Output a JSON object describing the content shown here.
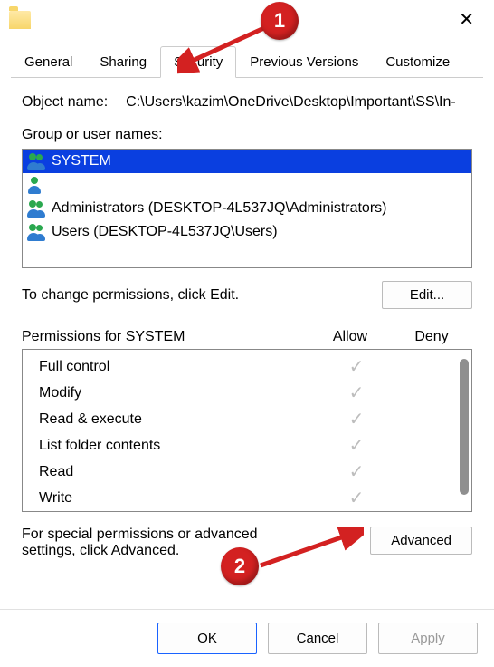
{
  "window": {
    "close_symbol": "✕"
  },
  "tabs": {
    "general": "General",
    "sharing": "Sharing",
    "security": "Security",
    "previous": "Previous Versions",
    "customize": "Customize"
  },
  "object": {
    "label": "Object name:",
    "path": "C:\\Users\\kazim\\OneDrive\\Desktop\\Important\\SS\\In-"
  },
  "groups": {
    "label": "Group or user names:",
    "items": [
      {
        "name": "SYSTEM",
        "selected": true,
        "icon": "duo"
      },
      {
        "name": "",
        "selected": false,
        "icon": "single"
      },
      {
        "name": "Administrators (DESKTOP-4L537JQ\\Administrators)",
        "selected": false,
        "icon": "duo"
      },
      {
        "name": "Users (DESKTOP-4L537JQ\\Users)",
        "selected": false,
        "icon": "duo"
      }
    ]
  },
  "edit": {
    "prompt": "To change permissions, click Edit.",
    "button": "Edit..."
  },
  "perms": {
    "header_label": "Permissions for SYSTEM",
    "allow": "Allow",
    "deny": "Deny",
    "rows": [
      {
        "name": "Full control",
        "allow": true
      },
      {
        "name": "Modify",
        "allow": true
      },
      {
        "name": "Read & execute",
        "allow": true
      },
      {
        "name": "List folder contents",
        "allow": true
      },
      {
        "name": "Read",
        "allow": true
      },
      {
        "name": "Write",
        "allow": true
      }
    ]
  },
  "advanced": {
    "prompt": "For special permissions or advanced settings, click Advanced.",
    "button": "Advanced"
  },
  "buttons": {
    "ok": "OK",
    "cancel": "Cancel",
    "apply": "Apply"
  },
  "annotations": {
    "one": "1",
    "two": "2"
  }
}
